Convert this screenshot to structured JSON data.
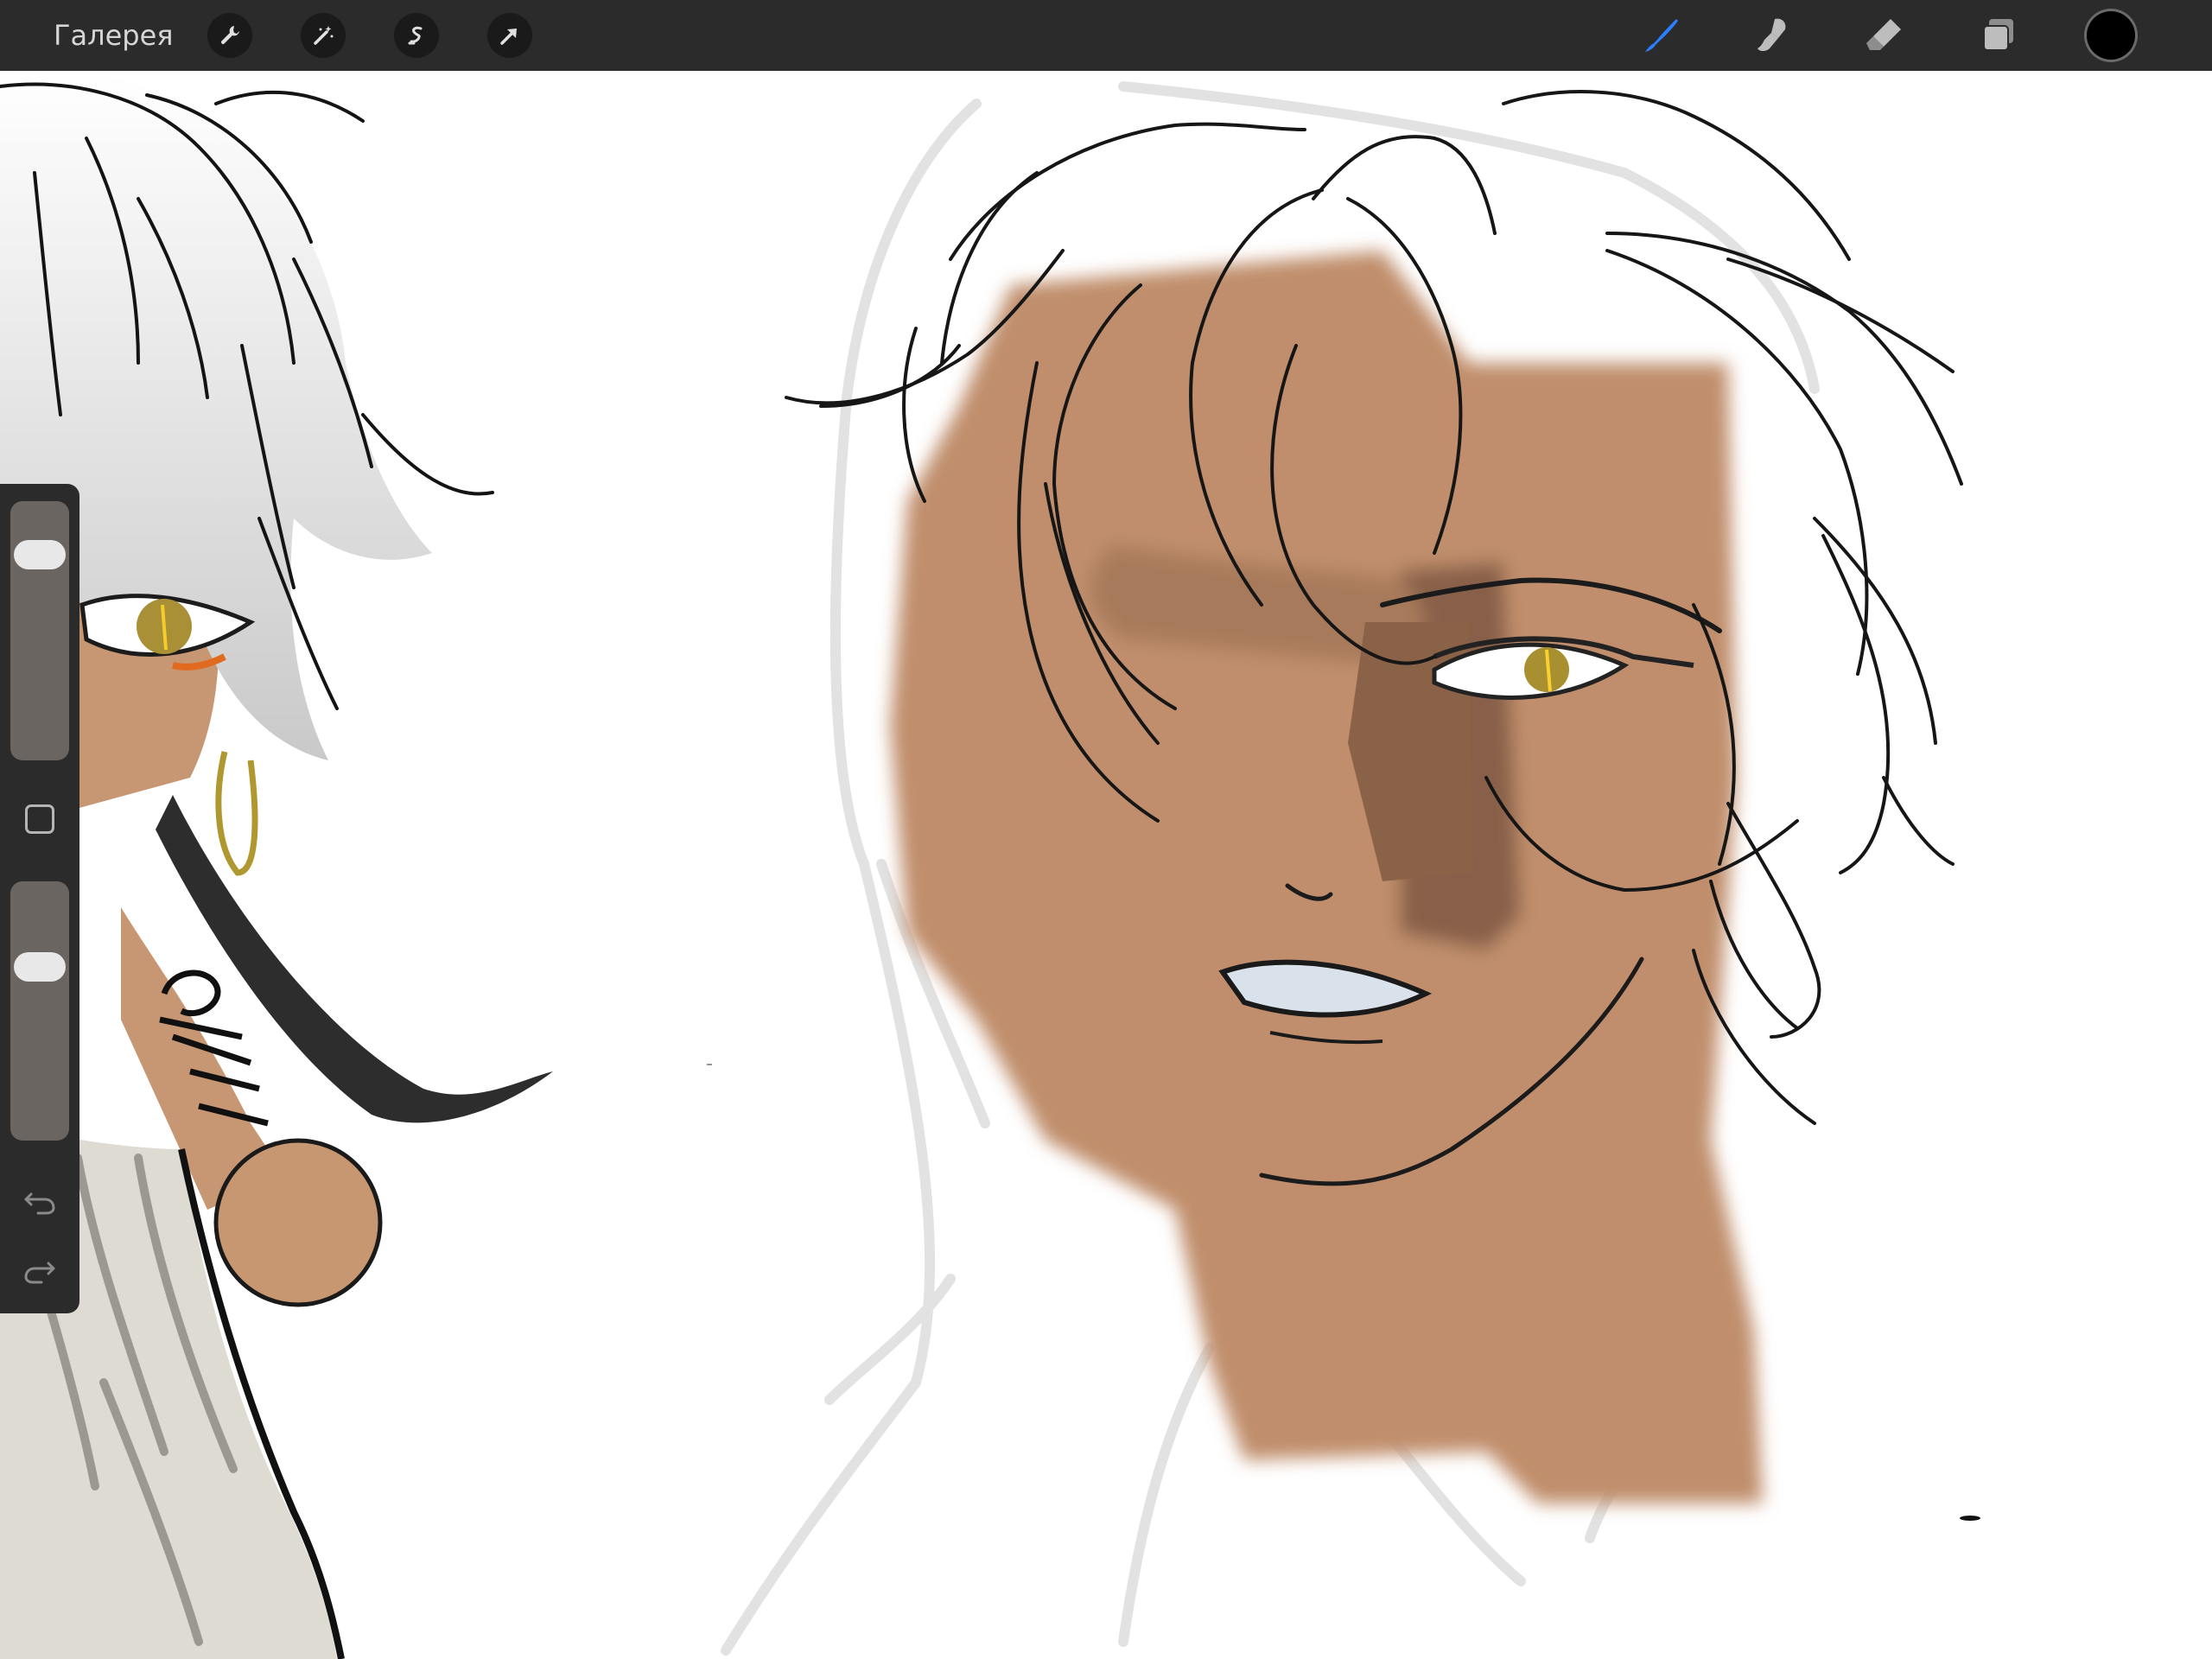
{
  "topbar": {
    "gallery_label": "Галерея",
    "left_tools": [
      "wrench-icon",
      "magic-wand-icon",
      "selection-icon",
      "transform-arrow-icon"
    ],
    "right_tools": [
      "brush-icon",
      "smudge-icon",
      "eraser-icon",
      "layers-icon"
    ],
    "active_tool": "brush",
    "accent_color": "#1a73e8",
    "current_color": "#000000"
  },
  "sidebar": {
    "brush_size": 0.15,
    "opacity": 0.3,
    "controls": [
      "brush-size-slider",
      "modify-button",
      "opacity-slider",
      "undo-icon",
      "redo-icon"
    ]
  },
  "canvas": {
    "background": "#ffffff",
    "skin_color": "#c08e6c",
    "shadow_color": "#886048",
    "eye_color": "#b09838",
    "hair_color": "#ffffff"
  }
}
